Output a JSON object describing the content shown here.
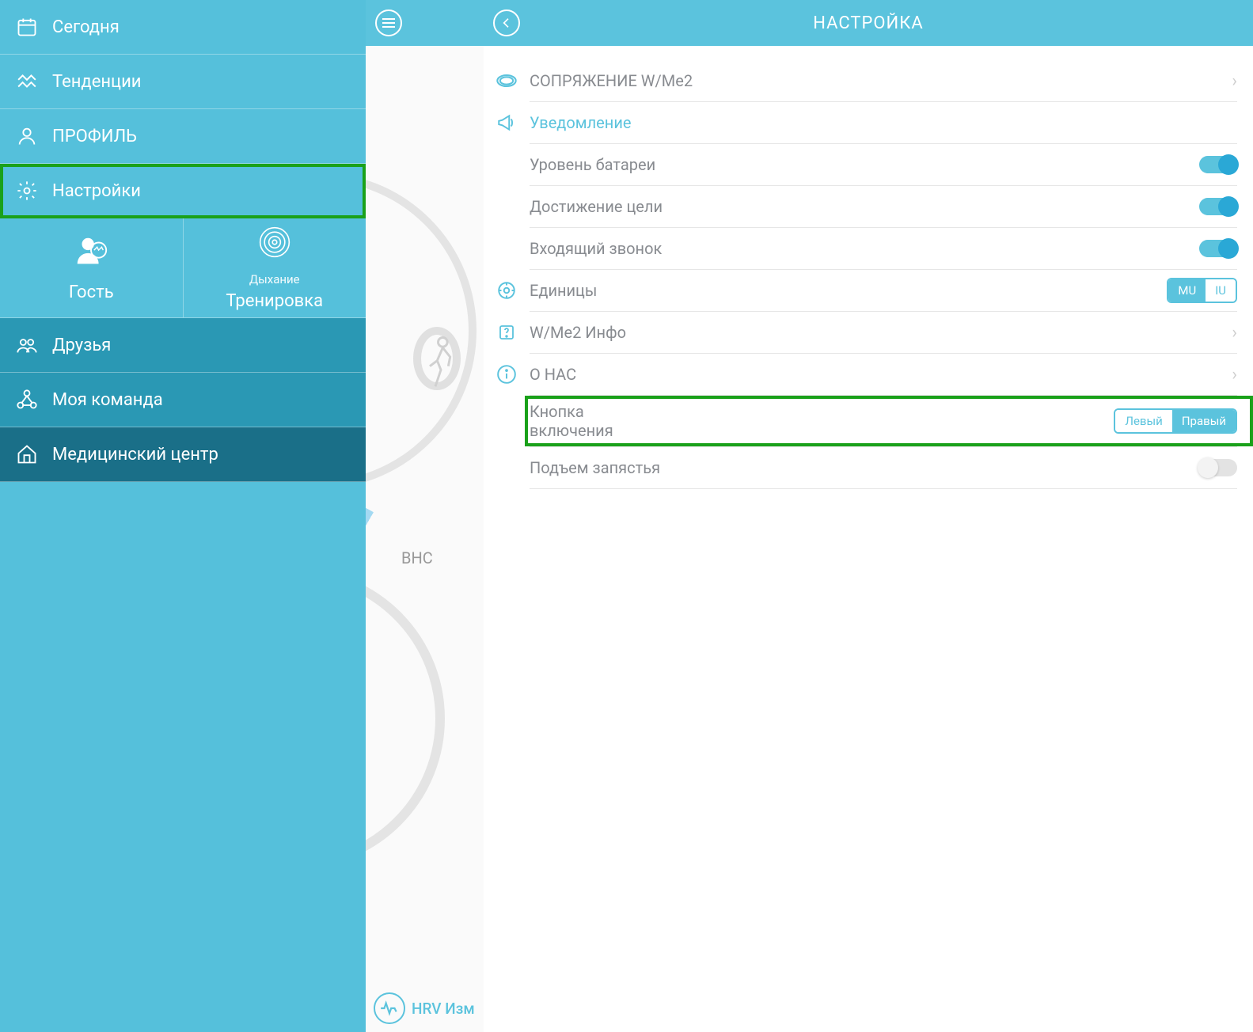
{
  "sidebar": {
    "items": [
      {
        "label": "Сегодня",
        "icon": "calendar-icon"
      },
      {
        "label": "Тенденции",
        "icon": "trends-icon"
      },
      {
        "label": "ПРОФИЛЬ",
        "icon": "profile-icon"
      },
      {
        "label": "Настройки",
        "icon": "gear-icon",
        "selected": true
      }
    ],
    "guest": {
      "label": "Гость"
    },
    "breath": {
      "small": "Дыхание",
      "big": "Тренировка"
    },
    "items2": [
      {
        "label": "Друзья",
        "icon": "friends-icon"
      },
      {
        "label": "Моя команда",
        "icon": "team-icon"
      },
      {
        "label": "Медицинский центр",
        "icon": "home-icon"
      }
    ]
  },
  "mid": {
    "bhc": "ВНС",
    "hrv": "HRV Изм"
  },
  "settings": {
    "title": "НАСТРОЙКА",
    "pairing": "СОПРЯЖЕНИЕ W/Me2",
    "notification": "Уведомление",
    "battery": "Уровень батареи",
    "goal": "Достижение цели",
    "incoming": "Входящий звонок",
    "units": {
      "label": "Единицы",
      "left": "MU",
      "right": "IU"
    },
    "info": "W/Me2 Инфо",
    "about": "О НАС",
    "power_button": {
      "label1": "Кнопка",
      "label2": "включения",
      "left": "Левый",
      "right": "Правый"
    },
    "wrist": "Подъем запястья"
  }
}
